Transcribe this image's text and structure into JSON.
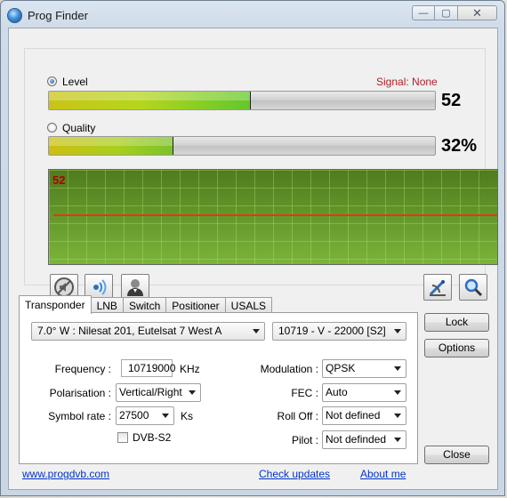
{
  "window": {
    "title": "Prog Finder",
    "minimize": "—",
    "maximize": "▢",
    "close": "✕"
  },
  "signal": {
    "level_label": "Level",
    "quality_label": "Quality",
    "signal_status": "Signal: None",
    "level_value": "52",
    "level_fraction": 0.52,
    "quality_value": "32%",
    "quality_fraction": 0.32,
    "selected_meter": "Level"
  },
  "scope": {
    "value": "52"
  },
  "toolbar_icons": [
    "mute-icon",
    "signal-sound-icon",
    "user-icon",
    "satellite-dish-icon",
    "magnifier-icon"
  ],
  "tabs": [
    {
      "label": "Transponder",
      "active": true
    },
    {
      "label": "LNB"
    },
    {
      "label": "Switch"
    },
    {
      "label": "Positioner"
    },
    {
      "label": "USALS"
    }
  ],
  "transponder": {
    "satellite": "7.0° W : Nilesat 201, Eutelsat 7 West A",
    "transponder": "10719 - V - 22000 [S2]",
    "frequency_label": "Frequency :",
    "frequency_value": "10719000",
    "frequency_unit": "KHz",
    "polarisation_label": "Polarisation :",
    "polarisation_value": "Vertical/Right",
    "symbol_rate_label": "Symbol rate :",
    "symbol_rate_value": "27500",
    "symbol_rate_unit": "Ks",
    "dvbs2_label": "DVB-S2",
    "dvbs2_checked": false,
    "modulation_label": "Modulation :",
    "modulation_value": "QPSK",
    "fec_label": "FEC :",
    "fec_value": "Auto",
    "rolloff_label": "Roll Off :",
    "rolloff_value": "Not defined",
    "pilot_label": "Pilot :",
    "pilot_value": "Not definded"
  },
  "buttons": {
    "lock": "Lock",
    "options": "Options",
    "close": "Close"
  },
  "footer": {
    "website": "www.progdvb.com",
    "check_updates": "Check updates",
    "about": "About me"
  },
  "colors": {
    "signal_status": "#b0202a",
    "scope_line": "#e03a10",
    "link": "#0033cc"
  }
}
